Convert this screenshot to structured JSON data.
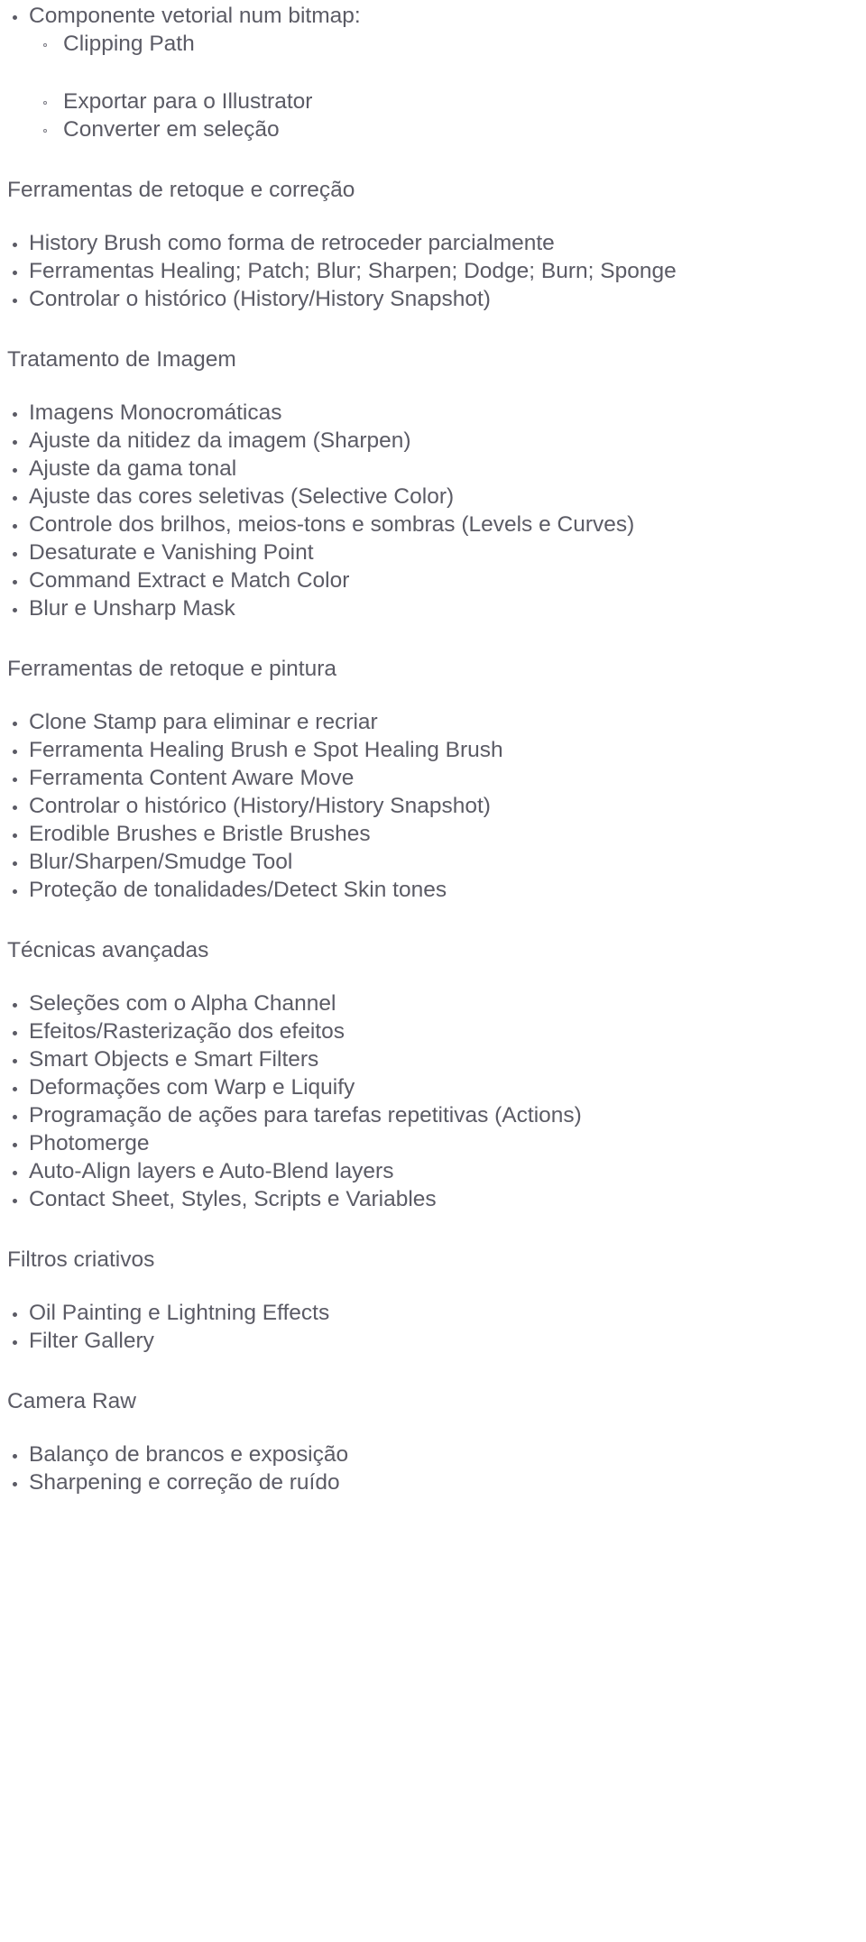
{
  "document": {
    "type": "course-syllabus-outline",
    "language": "pt-BR",
    "text_color": "#595962",
    "background_color": "#ffffff"
  },
  "blocks": {
    "b0_lvl1_item": "Componente vetorial num bitmap:",
    "b1_lvl2_items": [
      "Clipping Path"
    ],
    "b2_lvl2_items": [
      "Exportar para o Illustrator",
      "Converter em seleção"
    ],
    "b3_heading": "Ferramentas de retoque e correção",
    "b4_items": [
      "History Brush como forma de retroceder parcialmente",
      "Ferramentas Healing; Patch; Blur; Sharpen; Dodge; Burn; Sponge",
      "Controlar o histórico (History/History Snapshot)"
    ],
    "b5_heading": "Tratamento de Imagem",
    "b6_items": [
      "Imagens Monocromáticas",
      "Ajuste da nitidez da imagem (Sharpen)",
      "Ajuste da gama tonal",
      "Ajuste das cores seletivas (Selective Color)",
      "Controle dos brilhos, meios-tons e sombras (Levels e Curves)",
      "Desaturate e Vanishing Point",
      "Command Extract e Match Color",
      "Blur e Unsharp Mask"
    ],
    "b7_heading": "Ferramentas de retoque e pintura",
    "b8_items": [
      "Clone Stamp para eliminar e recriar",
      "Ferramenta Healing Brush e Spot Healing Brush",
      "Ferramenta Content Aware Move",
      "Controlar o histórico (History/History Snapshot)",
      "Erodible Brushes e Bristle Brushes",
      "Blur/Sharpen/Smudge Tool",
      "Proteção de tonalidades/Detect Skin tones"
    ],
    "b9_heading": "Técnicas avançadas",
    "b10_items": [
      "Seleções com o Alpha Channel",
      "Efeitos/Rasterização dos efeitos",
      "Smart Objects e Smart Filters",
      "Deformações com Warp e Liquify",
      "Programação de ações para tarefas repetitivas (Actions)",
      "Photomerge",
      "Auto-Align layers e Auto-Blend layers",
      "Contact Sheet, Styles, Scripts e Variables"
    ],
    "b11_heading": "Filtros criativos",
    "b12_items": [
      "Oil Painting e Lightning Effects",
      "Filter Gallery"
    ],
    "b13_heading": "Camera Raw",
    "b14_items": [
      "Balanço de brancos e exposição",
      "Sharpening e correção de ruído"
    ]
  }
}
